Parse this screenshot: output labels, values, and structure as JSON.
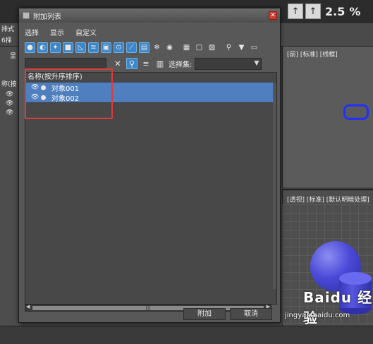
{
  "background": {
    "left_texts": [
      "排式",
      "6择",
      "显",
      "称(按",
      "5"
    ],
    "viewport_top_label": "[前] [标准] [线框]",
    "viewport_bottom_label": "[透视] [标准] [默认明暗处理]",
    "top_buttons": [
      "↑",
      "↑",
      "2.5",
      "%"
    ],
    "watermark_logo": "Baidu 经验",
    "watermark_url": "jingyan.baidu.com"
  },
  "dialog": {
    "title": "附加列表",
    "menu": [
      "选择",
      "显示",
      "自定义"
    ],
    "selection_set_label": "选择集:",
    "selection_set_value": "",
    "list_header": "名称(按升序排序)",
    "items": [
      {
        "label": "对象001"
      },
      {
        "label": "对象002"
      }
    ],
    "attach_button": "附加",
    "cancel_button": "取消"
  },
  "colors": {
    "selected_row": "#4f7fbf",
    "toolbar_active": "#3d86c8",
    "highlight_box": "#e03a3a"
  }
}
